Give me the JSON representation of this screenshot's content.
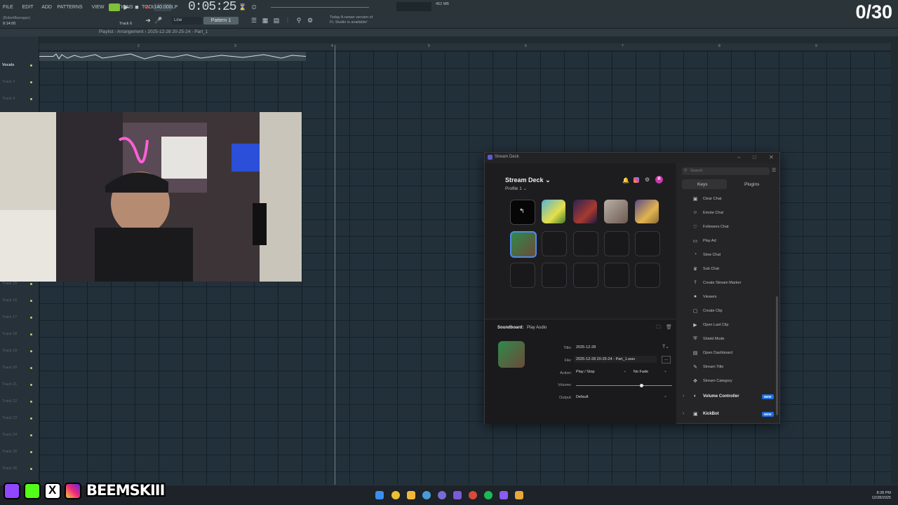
{
  "fl": {
    "menus": [
      "FILE",
      "EDIT",
      "ADD",
      "PATTERNS",
      "VIEW",
      "OPTIONS",
      "TOOLS",
      "HELP"
    ],
    "tempo": "140.000",
    "time": "0:05:25",
    "pattern": "Pattern 1",
    "mode": "Line",
    "user": "(RobertBarragan)",
    "elapsed": "9:14:00",
    "current_track": "Track 6",
    "news_line1": "Today  A newer version of",
    "news_line2": "FL Studio is available!",
    "cpu_text": "452 MB",
    "playlist_title": "Playlist - Arrangement › 2025-12-28 20-25-24 - Part_1",
    "ruler_marks": [
      "2",
      "3",
      "4",
      "5",
      "6",
      "7",
      "8",
      "9"
    ],
    "tracks": [
      {
        "label": "Vocals"
      },
      {
        "label": "Track 3"
      },
      {
        "label": "Track 4"
      },
      {
        "label": "Track 15"
      },
      {
        "label": "Track 16"
      },
      {
        "label": "Track 17"
      },
      {
        "label": "Track 18"
      },
      {
        "label": "Track 19"
      },
      {
        "label": "Track 20"
      },
      {
        "label": "Track 21"
      },
      {
        "label": "Track 22"
      },
      {
        "label": "Track 23"
      },
      {
        "label": "Track 24"
      },
      {
        "label": "Track 25"
      },
      {
        "label": "Track 26"
      }
    ]
  },
  "counter": "0/30",
  "streamdeck": {
    "window_title": "Stream Deck",
    "heading": "Stream Deck",
    "profile": "Profile 1",
    "avatar_initial": "R",
    "search_placeholder": "Search",
    "tabs": [
      "Keys",
      "Plugins"
    ],
    "actions": [
      {
        "label": "Clear Chat",
        "icon": "clear-chat-icon"
      },
      {
        "label": "Emote Chat",
        "icon": "emote-chat-icon"
      },
      {
        "label": "Followers Chat",
        "icon": "followers-chat-icon"
      },
      {
        "label": "Play Ad",
        "icon": "play-ad-icon"
      },
      {
        "label": "Slow Chat",
        "icon": "slow-chat-icon"
      },
      {
        "label": "Sub Chat",
        "icon": "sub-chat-icon"
      },
      {
        "label": "Create Stream Marker",
        "icon": "stream-marker-icon"
      },
      {
        "label": "Viewers",
        "icon": "viewers-icon"
      },
      {
        "label": "Create Clip",
        "icon": "create-clip-icon"
      },
      {
        "label": "Open Last Clip",
        "icon": "open-clip-icon"
      },
      {
        "label": "Shield Mode",
        "icon": "shield-icon"
      },
      {
        "label": "Open Dashboard",
        "icon": "dashboard-icon"
      },
      {
        "label": "Stream Title",
        "icon": "pencil-icon"
      },
      {
        "label": "Stream Category",
        "icon": "category-icon"
      }
    ],
    "categories": [
      {
        "label": "Volume Controller",
        "badge": "NEW"
      },
      {
        "label": "KickBot",
        "badge": "NEW"
      }
    ],
    "soundboard_label": "Soundboard:",
    "soundboard_action": "Play Audio",
    "props": {
      "title_label": "Title:",
      "title_value": "2025-12-28",
      "file_label": "File:",
      "file_value": "2025-12-28 20-25-24 - Part_1.wav",
      "browse": "...",
      "action_label": "Action:",
      "action_value": "Play / Stop",
      "fade_value": "No Fade",
      "volume_label": "Volume:",
      "volume_level": 0.68,
      "output_label": "Output:",
      "output_value": "Default"
    }
  },
  "socials": {
    "handle": "BEEMSKIII"
  },
  "taskbar": {
    "time": "8:28 PM",
    "date": "12/28/2025"
  }
}
